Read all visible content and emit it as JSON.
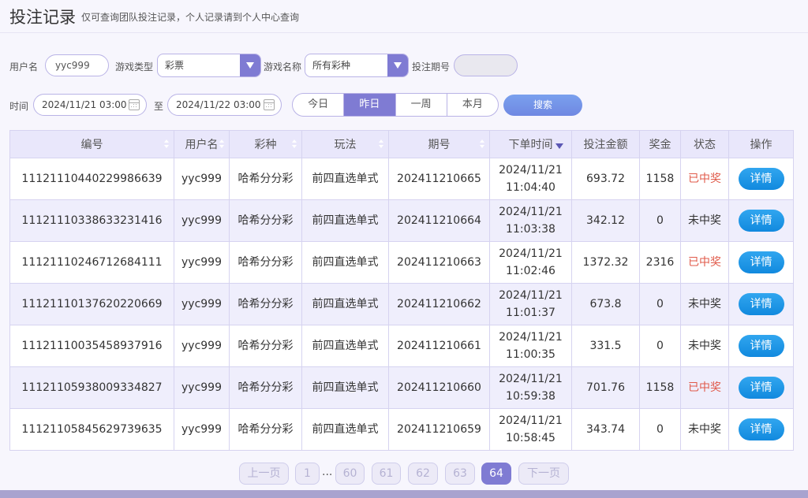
{
  "header": {
    "title": "投注记录",
    "subtitle": "仅可查询团队投注记录，个人记录请到个人中心查询"
  },
  "filters": {
    "username_label": "用户名",
    "username_value": "yyc999",
    "game_type_label": "游戏类型",
    "game_type_value": "彩票",
    "game_name_label": "游戏名称",
    "game_name_value": "所有彩种",
    "period_label": "投注期号",
    "period_value": "",
    "time_label": "时间",
    "time_start": "2024/11/21 03:00",
    "time_sep": "至",
    "time_end": "2024/11/22 03:00",
    "quick_ranges": [
      "今日",
      "昨日",
      "一周",
      "本月"
    ],
    "active_range": "昨日",
    "search_label": "搜索"
  },
  "table": {
    "headers": [
      "编号",
      "用户名",
      "彩种",
      "玩法",
      "期号",
      "下单时间",
      "投注金额",
      "奖金",
      "状态",
      "操作"
    ],
    "rows": [
      {
        "id": "11121110440229986639",
        "user": "yyc999",
        "lottery": "哈希分分彩",
        "play": "前四直选单式",
        "period": "202411210665",
        "date": "2024/11/21",
        "time": "11:04:40",
        "amount": "693.72",
        "prize": "1158",
        "status": "已中奖",
        "won": true,
        "action": "详情"
      },
      {
        "id": "11121110338633231416",
        "user": "yyc999",
        "lottery": "哈希分分彩",
        "play": "前四直选单式",
        "period": "202411210664",
        "date": "2024/11/21",
        "time": "11:03:38",
        "amount": "342.12",
        "prize": "0",
        "status": "未中奖",
        "won": false,
        "action": "详情"
      },
      {
        "id": "11121110246712684111",
        "user": "yyc999",
        "lottery": "哈希分分彩",
        "play": "前四直选单式",
        "period": "202411210663",
        "date": "2024/11/21",
        "time": "11:02:46",
        "amount": "1372.32",
        "prize": "2316",
        "status": "已中奖",
        "won": true,
        "action": "详情"
      },
      {
        "id": "11121110137620220669",
        "user": "yyc999",
        "lottery": "哈希分分彩",
        "play": "前四直选单式",
        "period": "202411210662",
        "date": "2024/11/21",
        "time": "11:01:37",
        "amount": "673.8",
        "prize": "0",
        "status": "未中奖",
        "won": false,
        "action": "详情"
      },
      {
        "id": "11121110035458937916",
        "user": "yyc999",
        "lottery": "哈希分分彩",
        "play": "前四直选单式",
        "period": "202411210661",
        "date": "2024/11/21",
        "time": "11:00:35",
        "amount": "331.5",
        "prize": "0",
        "status": "未中奖",
        "won": false,
        "action": "详情"
      },
      {
        "id": "11121105938009334827",
        "user": "yyc999",
        "lottery": "哈希分分彩",
        "play": "前四直选单式",
        "period": "202411210660",
        "date": "2024/11/21",
        "time": "10:59:38",
        "amount": "701.76",
        "prize": "1158",
        "status": "已中奖",
        "won": true,
        "action": "详情"
      },
      {
        "id": "11121105845629739635",
        "user": "yyc999",
        "lottery": "哈希分分彩",
        "play": "前四直选单式",
        "period": "202411210659",
        "date": "2024/11/21",
        "time": "10:58:45",
        "amount": "343.74",
        "prize": "0",
        "status": "未中奖",
        "won": false,
        "action": "详情"
      }
    ]
  },
  "pagination": {
    "prev": "上一页",
    "first": "1",
    "ellipsis": "...",
    "pages": [
      "60",
      "61",
      "62",
      "63",
      "64"
    ],
    "current": "64",
    "next": "下一页"
  },
  "colors": {
    "accent": "#7f7bd3",
    "won": "#e05a4a",
    "detail_button": "#1a94e4"
  }
}
